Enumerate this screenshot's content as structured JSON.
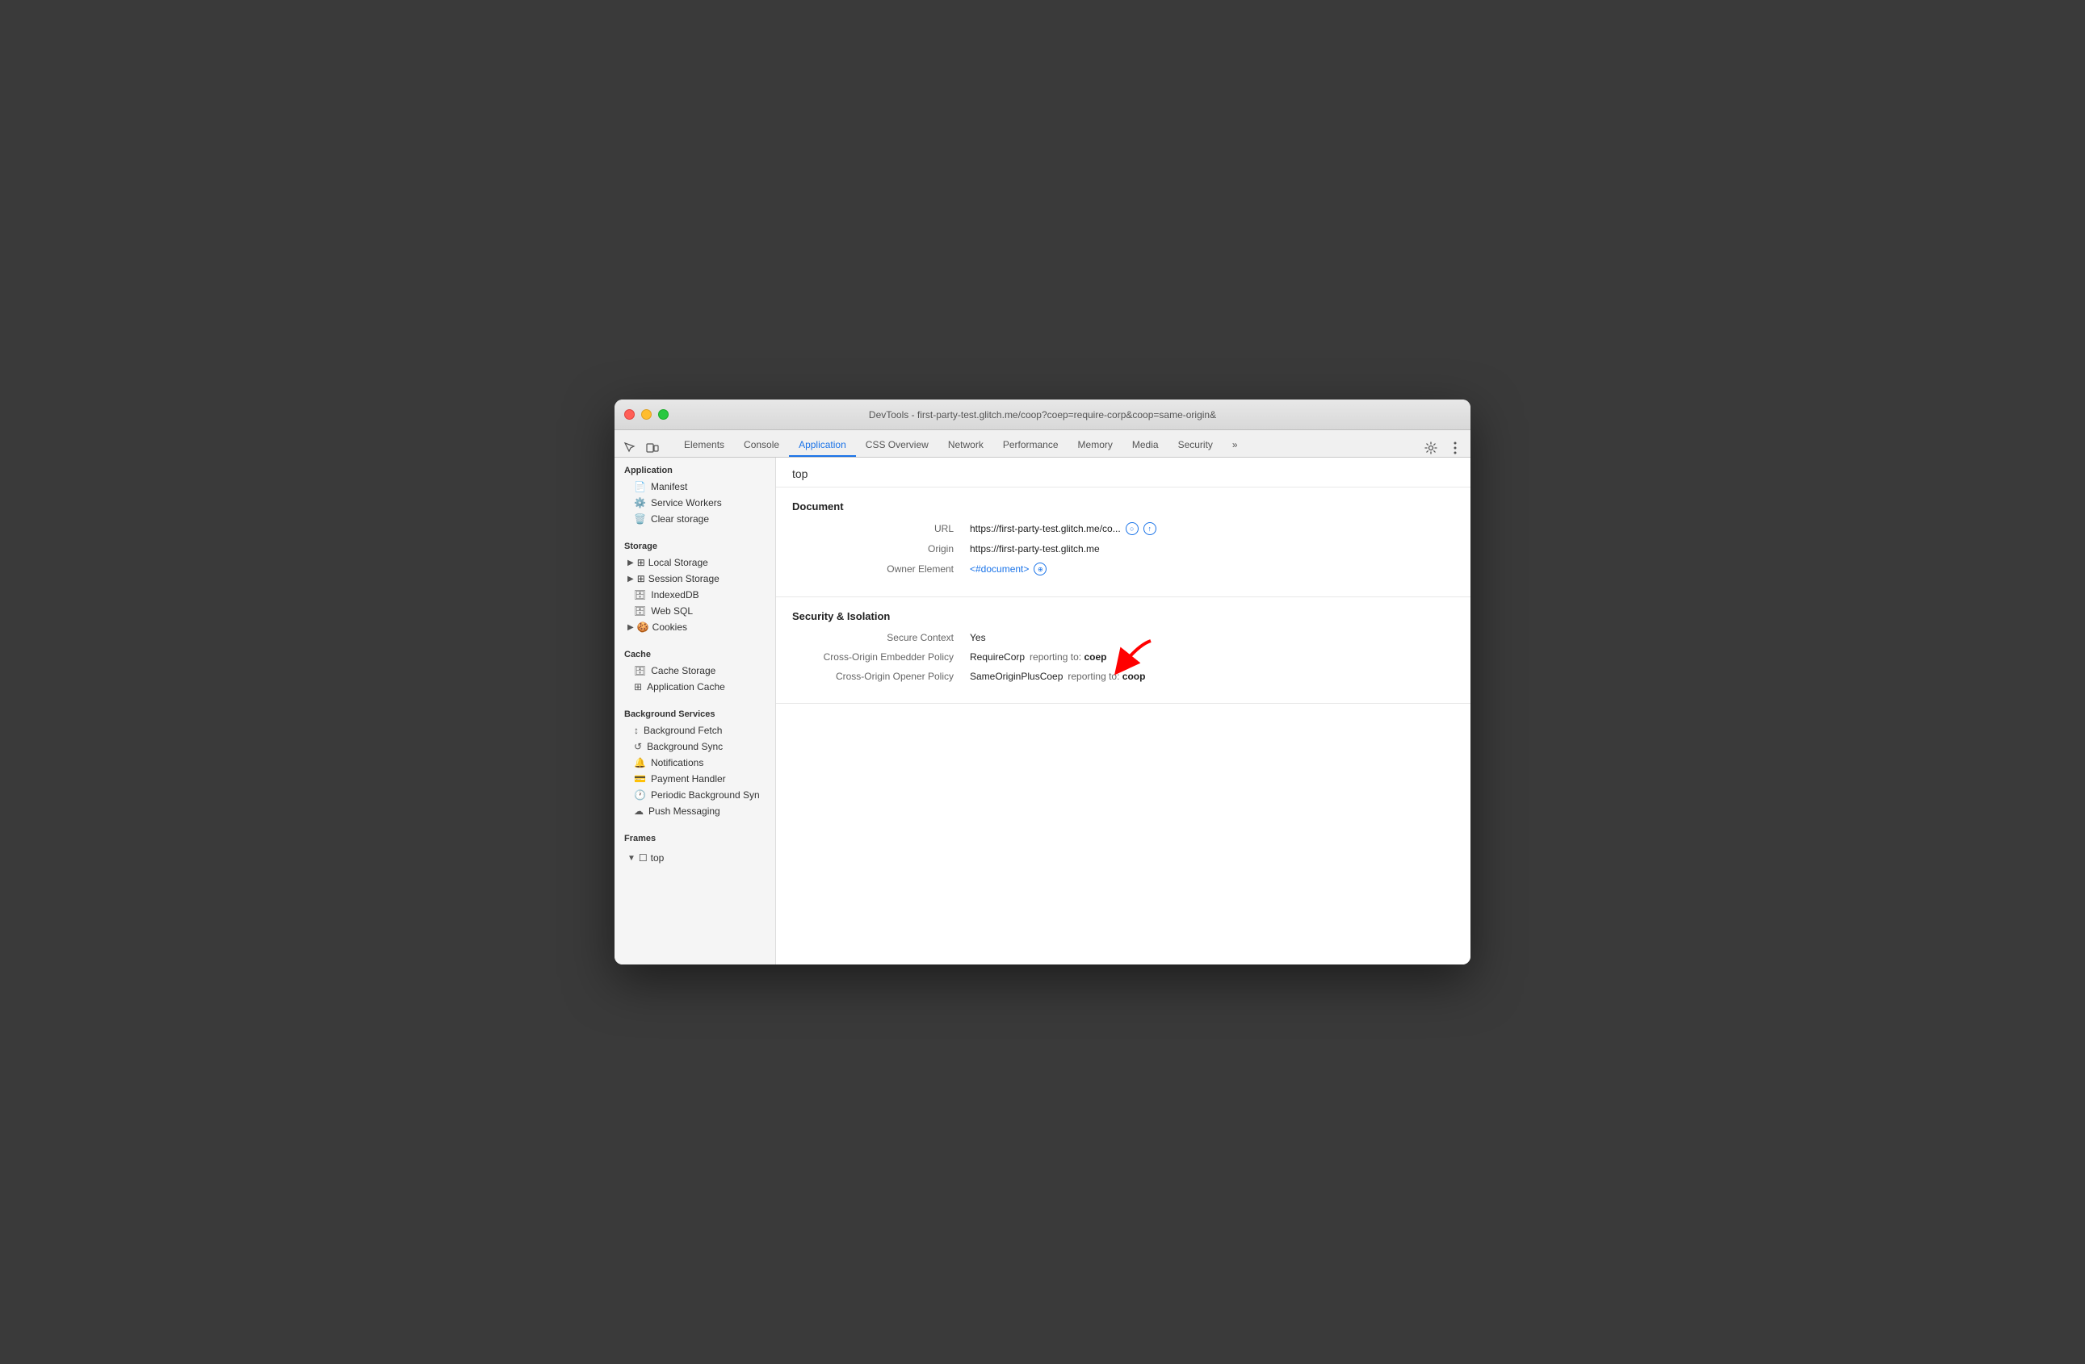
{
  "window": {
    "title": "DevTools - first-party-test.glitch.me/coop?coep=require-corp&coop=same-origin&"
  },
  "tabs": [
    {
      "id": "elements",
      "label": "Elements",
      "active": false
    },
    {
      "id": "console",
      "label": "Console",
      "active": false
    },
    {
      "id": "application",
      "label": "Application",
      "active": true
    },
    {
      "id": "css-overview",
      "label": "CSS Overview",
      "active": false
    },
    {
      "id": "network",
      "label": "Network",
      "active": false
    },
    {
      "id": "performance",
      "label": "Performance",
      "active": false
    },
    {
      "id": "memory",
      "label": "Memory",
      "active": false
    },
    {
      "id": "media",
      "label": "Media",
      "active": false
    },
    {
      "id": "security",
      "label": "Security",
      "active": false
    },
    {
      "id": "more",
      "label": "»",
      "active": false
    }
  ],
  "sidebar": {
    "application_label": "Application",
    "manifest_label": "Manifest",
    "service_workers_label": "Service Workers",
    "clear_storage_label": "Clear storage",
    "storage_label": "Storage",
    "local_storage_label": "Local Storage",
    "session_storage_label": "Session Storage",
    "indexed_db_label": "IndexedDB",
    "web_sql_label": "Web SQL",
    "cookies_label": "Cookies",
    "cache_label": "Cache",
    "cache_storage_label": "Cache Storage",
    "application_cache_label": "Application Cache",
    "background_services_label": "Background Services",
    "background_fetch_label": "Background Fetch",
    "background_sync_label": "Background Sync",
    "notifications_label": "Notifications",
    "payment_handler_label": "Payment Handler",
    "periodic_bg_sync_label": "Periodic Background Syn",
    "push_messaging_label": "Push Messaging",
    "frames_label": "Frames",
    "top_label": "top"
  },
  "content": {
    "frame_title": "top",
    "document_section": "Document",
    "url_label": "URL",
    "url_value": "https://first-party-test.glitch.me/co...",
    "origin_label": "Origin",
    "origin_value": "https://first-party-test.glitch.me",
    "owner_element_label": "Owner Element",
    "owner_element_value": "<#document>",
    "security_section": "Security & Isolation",
    "secure_context_label": "Secure Context",
    "secure_context_value": "Yes",
    "coep_label": "Cross-Origin Embedder Policy",
    "coep_policy": "RequireCorp",
    "coep_reporting": "reporting to:",
    "coep_endpoint": "coep",
    "coop_label": "Cross-Origin Opener Policy",
    "coop_policy": "SameOriginPlusCoep",
    "coop_reporting": "reporting to:",
    "coop_endpoint": "coop"
  }
}
